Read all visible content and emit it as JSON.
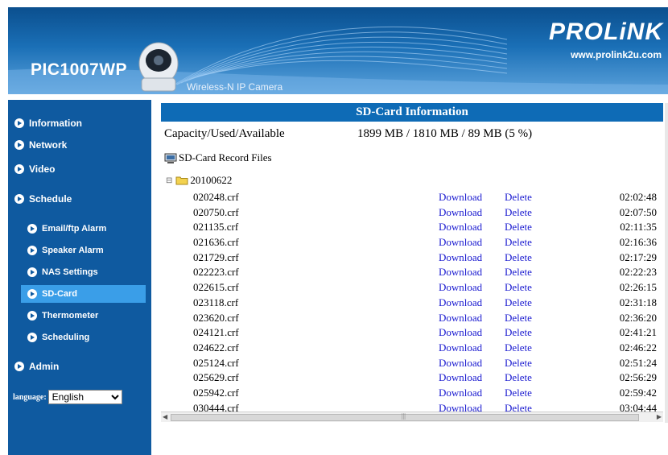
{
  "header": {
    "model": "PIC1007WP",
    "tagline": "Wireless-N IP Camera",
    "brand": "PROLiNK",
    "url": "www.prolink2u.com"
  },
  "sidebar": {
    "items": {
      "information": "Information",
      "network": "Network",
      "video": "Video",
      "schedule": "Schedule",
      "email_ftp_alarm": "Email/ftp Alarm",
      "speaker_alarm": "Speaker Alarm",
      "nas_settings": "NAS Settings",
      "sd_card": "SD-Card",
      "thermometer": "Thermometer",
      "scheduling": "Scheduling",
      "admin": "Admin"
    },
    "active_item": "SD-Card",
    "language_label": "language:",
    "language_value": "English"
  },
  "main": {
    "title": "SD-Card Information",
    "capacity_label": "Capacity/Used/Available",
    "capacity_value": "1899 MB / 1810 MB / 89 MB (5 %)",
    "record_files_label": "SD-Card Record Files",
    "folder": "20100622",
    "download_label": "Download",
    "delete_label": "Delete",
    "files": [
      {
        "name": "020248.crf",
        "time": "02:02:48"
      },
      {
        "name": "020750.crf",
        "time": "02:07:50"
      },
      {
        "name": "021135.crf",
        "time": "02:11:35"
      },
      {
        "name": "021636.crf",
        "time": "02:16:36"
      },
      {
        "name": "021729.crf",
        "time": "02:17:29"
      },
      {
        "name": "022223.crf",
        "time": "02:22:23"
      },
      {
        "name": "022615.crf",
        "time": "02:26:15"
      },
      {
        "name": "023118.crf",
        "time": "02:31:18"
      },
      {
        "name": "023620.crf",
        "time": "02:36:20"
      },
      {
        "name": "024121.crf",
        "time": "02:41:21"
      },
      {
        "name": "024622.crf",
        "time": "02:46:22"
      },
      {
        "name": "025124.crf",
        "time": "02:51:24"
      },
      {
        "name": "025629.crf",
        "time": "02:56:29"
      },
      {
        "name": "025942.crf",
        "time": "02:59:42"
      },
      {
        "name": "030444.crf",
        "time": "03:04:44"
      }
    ]
  },
  "colors": {
    "sidebar_bg": "#0f5aa0",
    "active_bg": "#3a9ee8",
    "title_bar": "#0e6bb6",
    "link": "#1a1ad0"
  }
}
